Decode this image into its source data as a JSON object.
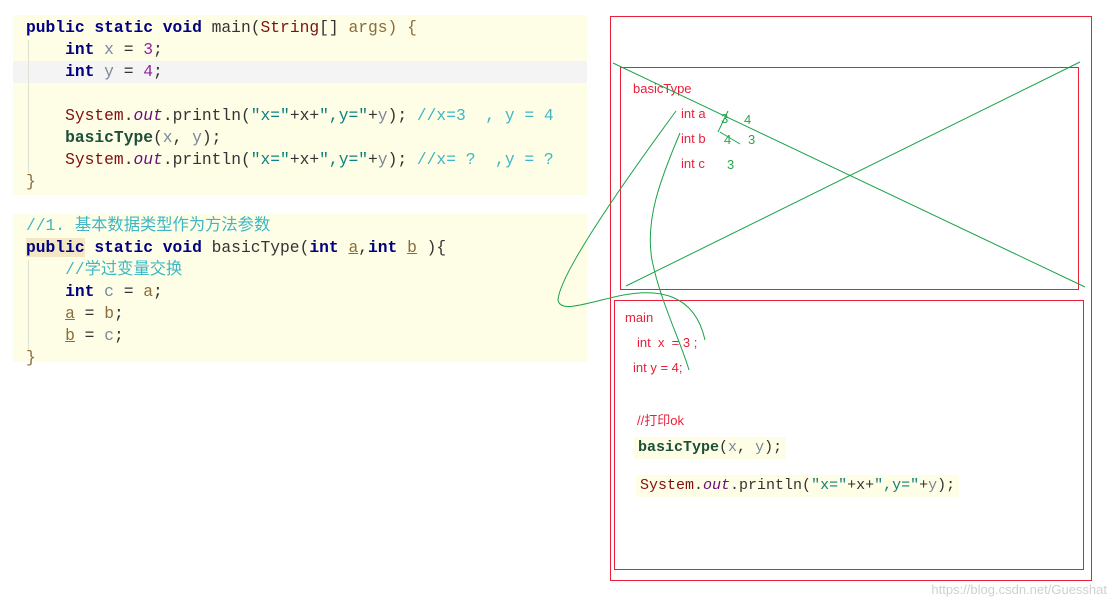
{
  "code_main": [
    [
      {
        "t": "public static void ",
        "c": "kw"
      },
      {
        "t": "main",
        "c": "pl"
      },
      {
        "t": "(",
        "c": "pl"
      },
      {
        "t": "String",
        "c": "cls"
      },
      {
        "t": "[] ",
        "c": "pl"
      },
      {
        "t": "args",
        "c": "par"
      },
      {
        "t": ") {",
        "c": "brace"
      }
    ],
    [
      {
        "t": "    int ",
        "c": "kw"
      },
      {
        "t": "x",
        "c": "var"
      },
      {
        "t": " = ",
        "c": "pl"
      },
      {
        "t": "3",
        "c": "num"
      },
      {
        "t": ";",
        "c": "pl"
      }
    ],
    [
      {
        "t": "    int ",
        "c": "kw"
      },
      {
        "t": "y",
        "c": "var"
      },
      {
        "t": " = ",
        "c": "pl"
      },
      {
        "t": "4",
        "c": "num"
      },
      {
        "t": ";",
        "c": "pl"
      }
    ],
    [],
    [
      {
        "t": "    System",
        "c": "cls"
      },
      {
        "t": ".",
        "c": "pl"
      },
      {
        "t": "out",
        "c": "fld"
      },
      {
        "t": ".println(",
        "c": "pl"
      },
      {
        "t": "\"x=\"",
        "c": "str"
      },
      {
        "t": "+x+",
        "c": "pl"
      },
      {
        "t": "\",y=\"",
        "c": "str"
      },
      {
        "t": "+",
        "c": "pl"
      },
      {
        "t": "y",
        "c": "var"
      },
      {
        "t": "); ",
        "c": "pl"
      },
      {
        "t": "//x=3  , y = 4",
        "c": "cmt"
      }
    ],
    [
      {
        "t": "    basicType",
        "c": "mth"
      },
      {
        "t": "(",
        "c": "pl"
      },
      {
        "t": "x",
        "c": "var"
      },
      {
        "t": ", ",
        "c": "pl"
      },
      {
        "t": "y",
        "c": "var"
      },
      {
        "t": ");",
        "c": "pl"
      }
    ],
    [
      {
        "t": "    System",
        "c": "cls"
      },
      {
        "t": ".",
        "c": "pl"
      },
      {
        "t": "out",
        "c": "fld"
      },
      {
        "t": ".println(",
        "c": "pl"
      },
      {
        "t": "\"x=\"",
        "c": "str"
      },
      {
        "t": "+x+",
        "c": "pl"
      },
      {
        "t": "\",y=\"",
        "c": "str"
      },
      {
        "t": "+",
        "c": "pl"
      },
      {
        "t": "y",
        "c": "var"
      },
      {
        "t": "); ",
        "c": "pl"
      },
      {
        "t": "//x= ?  ,y = ?",
        "c": "cmt"
      }
    ],
    [
      {
        "t": "}",
        "c": "brace"
      }
    ]
  ],
  "code_basic": [
    [
      {
        "t": "//1. 基本数据类型作为方法参数",
        "c": "cmt"
      }
    ],
    [
      {
        "t": "public",
        "c": "kw hlkw"
      },
      {
        "t": " static void ",
        "c": "kw"
      },
      {
        "t": "basicType",
        "c": "pl"
      },
      {
        "t": "(",
        "c": "pl"
      },
      {
        "t": "int ",
        "c": "kw"
      },
      {
        "t": "a",
        "c": "upar"
      },
      {
        "t": ",",
        "c": "pl"
      },
      {
        "t": "int ",
        "c": "kw"
      },
      {
        "t": "b",
        "c": "upar"
      },
      {
        "t": " ){",
        "c": "pl"
      }
    ],
    [
      {
        "t": "    //学过变量交换",
        "c": "cmt"
      }
    ],
    [
      {
        "t": "    int ",
        "c": "kw"
      },
      {
        "t": "c",
        "c": "var"
      },
      {
        "t": " = ",
        "c": "pl"
      },
      {
        "t": "a",
        "c": "par"
      },
      {
        "t": ";",
        "c": "pl"
      }
    ],
    [
      {
        "t": "    ",
        "c": "pl"
      },
      {
        "t": "a",
        "c": "upar"
      },
      {
        "t": " = ",
        "c": "pl"
      },
      {
        "t": "b",
        "c": "par"
      },
      {
        "t": ";",
        "c": "pl"
      }
    ],
    [
      {
        "t": "    ",
        "c": "pl"
      },
      {
        "t": "b",
        "c": "upar"
      },
      {
        "t": " = ",
        "c": "pl"
      },
      {
        "t": "c",
        "c": "var"
      },
      {
        "t": ";",
        "c": "pl"
      }
    ],
    [
      {
        "t": "}",
        "c": "brace"
      }
    ]
  ],
  "diagram": {
    "basic_frame": {
      "title": "basicType",
      "int_a": "int a",
      "int_b": "int b",
      "int_c": "int c",
      "a_old": "3",
      "a_new": "4",
      "b_old": "4",
      "b_new": "3",
      "c_val": "3"
    },
    "main_frame": {
      "title": "main",
      "int_x": "int  x  = 3 ;",
      "int_y": "int y = 4;",
      "comment": "//打印ok"
    },
    "snippet1": [
      {
        "t": "basicType",
        "c": "mth"
      },
      {
        "t": "(",
        "c": "pl"
      },
      {
        "t": "x",
        "c": "var"
      },
      {
        "t": ", ",
        "c": "pl"
      },
      {
        "t": "y",
        "c": "var"
      },
      {
        "t": ");",
        "c": "pl"
      }
    ],
    "snippet2": [
      {
        "t": "System",
        "c": "cls"
      },
      {
        "t": ".",
        "c": "pl"
      },
      {
        "t": "out",
        "c": "fld"
      },
      {
        "t": ".println(",
        "c": "pl"
      },
      {
        "t": "\"x=\"",
        "c": "str"
      },
      {
        "t": "+x+",
        "c": "pl"
      },
      {
        "t": "\",y=\"",
        "c": "str"
      },
      {
        "t": "+",
        "c": "pl"
      },
      {
        "t": "y",
        "c": "var"
      },
      {
        "t": ");",
        "c": "pl"
      }
    ],
    "colors": {
      "frame": "#e8203a",
      "annotation": "#1aa34a"
    }
  },
  "watermark": "https://blog.csdn.net/Guesshat"
}
